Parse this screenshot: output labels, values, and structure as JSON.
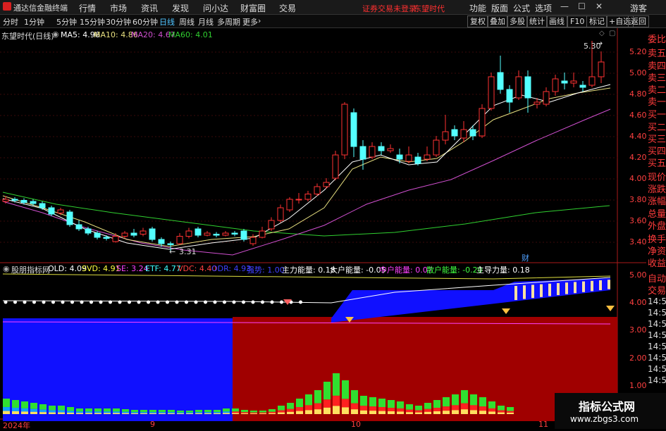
{
  "app": {
    "title": "通达信金融终端",
    "menus": [
      "行情",
      "市场",
      "资讯",
      "发现",
      "问小达",
      "财富圈",
      "交易"
    ],
    "status": "证券交易未登录",
    "stock_name": "东望时代",
    "right_menus": [
      "功能",
      "版面",
      "公式",
      "选项"
    ],
    "guest": "游客"
  },
  "toolbar": {
    "periods": [
      "分时",
      "1分钟",
      "5分钟",
      "15分钟",
      "30分钟",
      "60分钟",
      "日线",
      "周线",
      "月线",
      "多周期",
      "更多"
    ],
    "active_period": "日线",
    "buttons": [
      "复权",
      "叠加",
      "多股",
      "统计",
      "画线",
      "F10",
      "标记",
      "+自选",
      "返回"
    ]
  },
  "main_legend": {
    "title": "东望时代(日线)",
    "ma": [
      {
        "label": "MA5: 4.96",
        "color": "#ffffff"
      },
      {
        "label": "MA10: 4.86",
        "color": "#e8e080"
      },
      {
        "label": "MA20: 4.67",
        "color": "#d050d0"
      },
      {
        "label": "MA60: 4.01",
        "color": "#30d030"
      }
    ]
  },
  "price_axis": [
    "5.20",
    "5.00",
    "4.80",
    "4.60",
    "4.40",
    "4.20",
    "4.00",
    "3.80",
    "3.60",
    "3.40"
  ],
  "annotations": {
    "high": "5.30",
    "low": "3.31",
    "fin_mark": "财"
  },
  "right_panel": [
    "委比",
    "卖五",
    "卖四",
    "卖三",
    "卖二",
    "卖一",
    "买一",
    "买二",
    "买三",
    "买四",
    "买五",
    "现价",
    "涨跌",
    "涨幅",
    "总量",
    "外盘",
    "换手",
    "净资",
    "收益"
  ],
  "indicator_legend": {
    "name": "股朋指标网",
    "items": [
      {
        "label": "OLD: 4.09",
        "color": "#ffffff"
      },
      {
        "label": "SVD: 4.91",
        "color": "#ffff40"
      },
      {
        "label": "SE: 3.24",
        "color": "#ff40ff"
      },
      {
        "label": "ETF: 4.77",
        "color": "#40ffff"
      },
      {
        "label": "VDC: 4.40",
        "color": "#ff4040"
      },
      {
        "label": "ODR: 4.93",
        "color": "#4040ff"
      },
      {
        "label": "强势: 1.00",
        "color": "#4040ff"
      },
      {
        "label": "主力能量: 0.18",
        "color": "#ffffff"
      },
      {
        "label": "大户能量: -0.05",
        "color": "#ffffff"
      },
      {
        "label": "中户能量: 0.07",
        "color": "#ff40ff"
      },
      {
        "label": "散户能量: -0.20",
        "color": "#40ff40"
      },
      {
        "label": "主导力量: 0.18",
        "color": "#ffffff"
      }
    ]
  },
  "indicator_axis": [
    "5.00",
    "4.00",
    "3.00",
    "2.00",
    "1.00"
  ],
  "right_times": [
    "自动",
    "交易",
    "14:55",
    "14:56",
    "14:56",
    "14:56",
    "14:56",
    "14:56",
    "14:56",
    "14:56"
  ],
  "date_axis": [
    "2024年",
    "9",
    "10",
    "11"
  ],
  "watermark": {
    "title": "指标公式网",
    "url": "www.zbgs3.com"
  }
}
